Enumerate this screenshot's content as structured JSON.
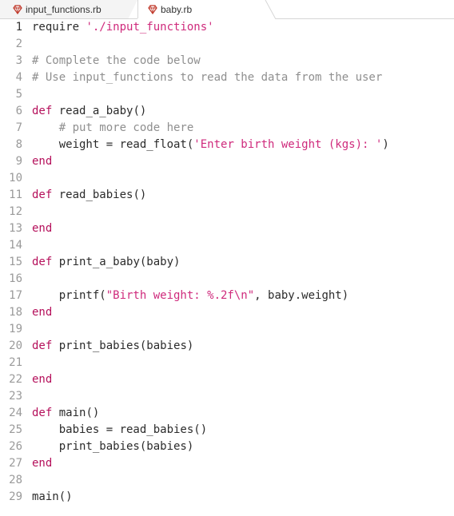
{
  "tabs": [
    {
      "label": "input_functions.rb",
      "active": false,
      "icon": "ruby-icon"
    },
    {
      "label": "baby.rb",
      "active": true,
      "icon": "ruby-icon"
    }
  ],
  "colors": {
    "keyword": "#b5105b",
    "string": "#cf2a7c",
    "comment": "#8f8f8f",
    "text": "#2b2b2b",
    "line_number": "#9a9a9a",
    "ruby_icon": "#c0392b"
  },
  "editor": {
    "language": "ruby",
    "active_line": 1,
    "lines": [
      {
        "n": "1",
        "tokens": [
          {
            "t": "plain",
            "v": "require "
          },
          {
            "t": "str",
            "v": "'./input_functions'"
          }
        ]
      },
      {
        "n": "2",
        "tokens": []
      },
      {
        "n": "3",
        "tokens": [
          {
            "t": "cm",
            "v": "# Complete the code below"
          }
        ]
      },
      {
        "n": "4",
        "tokens": [
          {
            "t": "cm",
            "v": "# Use input_functions to read the data from the user"
          }
        ]
      },
      {
        "n": "5",
        "tokens": []
      },
      {
        "n": "6",
        "tokens": [
          {
            "t": "kw",
            "v": "def"
          },
          {
            "t": "plain",
            "v": " read_a_baby()"
          }
        ]
      },
      {
        "n": "7",
        "tokens": [
          {
            "t": "plain",
            "v": "    "
          },
          {
            "t": "cm",
            "v": "# put more code here"
          }
        ]
      },
      {
        "n": "8",
        "tokens": [
          {
            "t": "plain",
            "v": "    weight = read_float("
          },
          {
            "t": "str",
            "v": "'Enter birth weight (kgs): '"
          },
          {
            "t": "plain",
            "v": ")"
          }
        ]
      },
      {
        "n": "9",
        "tokens": [
          {
            "t": "kw",
            "v": "end"
          }
        ]
      },
      {
        "n": "10",
        "tokens": []
      },
      {
        "n": "11",
        "tokens": [
          {
            "t": "kw",
            "v": "def"
          },
          {
            "t": "plain",
            "v": " read_babies()"
          }
        ]
      },
      {
        "n": "12",
        "tokens": []
      },
      {
        "n": "13",
        "tokens": [
          {
            "t": "kw",
            "v": "end"
          }
        ]
      },
      {
        "n": "14",
        "tokens": []
      },
      {
        "n": "15",
        "tokens": [
          {
            "t": "kw",
            "v": "def"
          },
          {
            "t": "plain",
            "v": " print_a_baby(baby)"
          }
        ]
      },
      {
        "n": "16",
        "tokens": []
      },
      {
        "n": "17",
        "tokens": [
          {
            "t": "plain",
            "v": "    printf("
          },
          {
            "t": "str",
            "v": "\"Birth weight: %.2f\\n\""
          },
          {
            "t": "plain",
            "v": ", baby.weight)"
          }
        ]
      },
      {
        "n": "18",
        "tokens": [
          {
            "t": "kw",
            "v": "end"
          }
        ]
      },
      {
        "n": "19",
        "tokens": []
      },
      {
        "n": "20",
        "tokens": [
          {
            "t": "kw",
            "v": "def"
          },
          {
            "t": "plain",
            "v": " print_babies(babies)"
          }
        ]
      },
      {
        "n": "21",
        "tokens": []
      },
      {
        "n": "22",
        "tokens": [
          {
            "t": "kw",
            "v": "end"
          }
        ]
      },
      {
        "n": "23",
        "tokens": []
      },
      {
        "n": "24",
        "tokens": [
          {
            "t": "kw",
            "v": "def"
          },
          {
            "t": "plain",
            "v": " main()"
          }
        ]
      },
      {
        "n": "25",
        "tokens": [
          {
            "t": "plain",
            "v": "    babies = read_babies()"
          }
        ]
      },
      {
        "n": "26",
        "tokens": [
          {
            "t": "plain",
            "v": "    print_babies(babies)"
          }
        ]
      },
      {
        "n": "27",
        "tokens": [
          {
            "t": "kw",
            "v": "end"
          }
        ]
      },
      {
        "n": "28",
        "tokens": []
      },
      {
        "n": "29",
        "tokens": [
          {
            "t": "plain",
            "v": "main()"
          }
        ]
      }
    ]
  }
}
